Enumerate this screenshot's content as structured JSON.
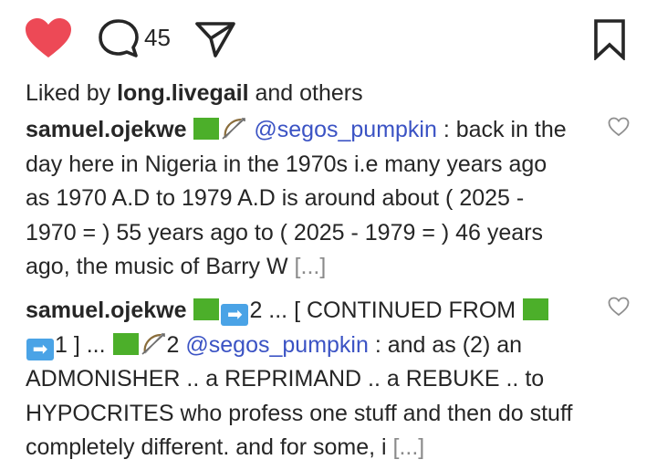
{
  "actions": {
    "like_icon": "heart-filled-icon",
    "like_color": "#ed4956",
    "comment_icon": "comment-bubble-icon",
    "comment_count": "45",
    "share_icon": "paper-plane-icon",
    "save_icon": "bookmark-icon"
  },
  "likes": {
    "prefix": "Liked by ",
    "user": "long.livegail",
    "suffix": " and others"
  },
  "comments": [
    {
      "username": "samuel.ojekwe",
      "mention": "@segos_pumpkin",
      "text_after_mention": " : back in the day here in Nigeria in the 1970s i.e many years ago as 1970 A.D to 1979 A.D is around about ( 2025 - 1970 = ) 55 years ago to ( 2025 - 1979 = ) 46 years ago, the music of Barry W ",
      "more": "[...]"
    },
    {
      "username": "samuel.ojekwe",
      "part_a": "2 ... [ CONTINUED FROM ",
      "part_b": "1 ] ... ",
      "part_c": "2 ",
      "mention": "@segos_pumpkin",
      "text_after_mention": " : and as (2) an ADMONISHER .. a REPRIMAND .. a REBUKE .. to HYPOCRITES who profess one stuff and then do stuff completely different. and for some, i ",
      "more": "[...]"
    }
  ],
  "colors": {
    "mention": "#3b53c4",
    "emoji_green": "#4caf2a",
    "emoji_arrow": "#4aa3e6"
  }
}
